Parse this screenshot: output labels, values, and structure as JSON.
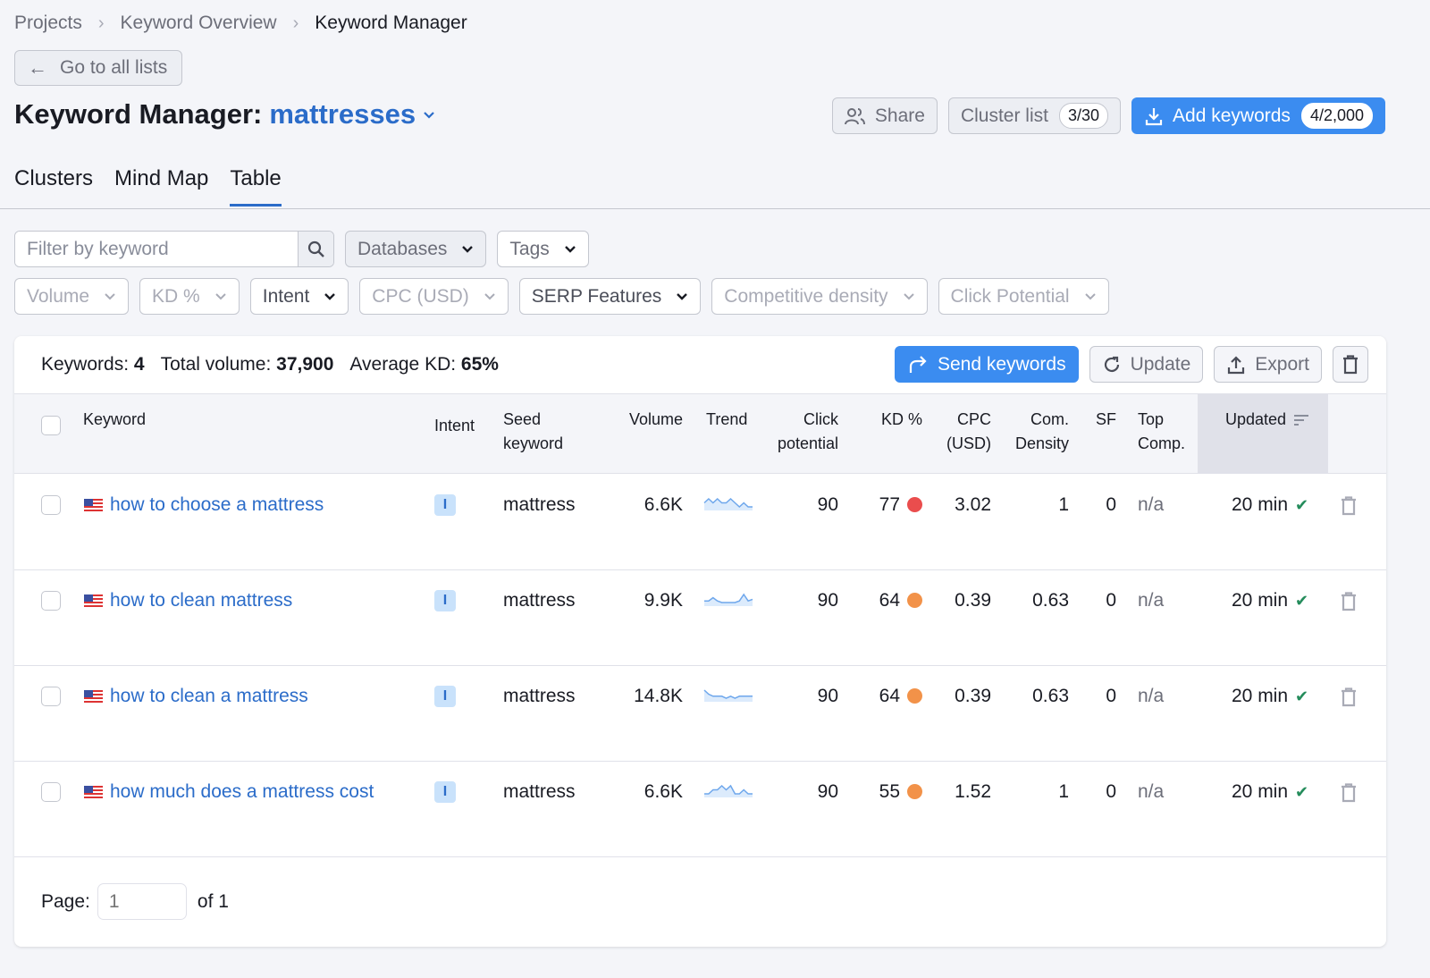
{
  "breadcrumb": [
    "Projects",
    "Keyword Overview",
    "Keyword Manager"
  ],
  "back_button": "Go to all lists",
  "title": {
    "prefix": "Keyword Manager:",
    "list_name": "mattresses"
  },
  "header_actions": {
    "share": "Share",
    "cluster_list": "Cluster list",
    "cluster_count": "3/30",
    "add_keywords": "Add keywords",
    "add_count": "4/2,000"
  },
  "tabs": [
    {
      "label": "Clusters",
      "active": false
    },
    {
      "label": "Mind Map",
      "active": false
    },
    {
      "label": "Table",
      "active": true
    }
  ],
  "filters": {
    "search_placeholder": "Filter by keyword",
    "databases": "Databases",
    "tags": "Tags",
    "volume": "Volume",
    "kd": "KD %",
    "intent": "Intent",
    "cpc": "CPC (USD)",
    "serp": "SERP Features",
    "competitive_density": "Competitive density",
    "click_potential": "Click Potential"
  },
  "summary": {
    "keywords_label": "Keywords:",
    "keywords_value": "4",
    "volume_label": "Total volume:",
    "volume_value": "37,900",
    "kd_label": "Average KD:",
    "kd_value": "65%"
  },
  "table_actions": {
    "send": "Send keywords",
    "update": "Update",
    "export": "Export"
  },
  "columns": {
    "keyword": "Keyword",
    "intent": "Intent",
    "seed_1": "Seed",
    "seed_2": "keyword",
    "volume": "Volume",
    "trend": "Trend",
    "click_1": "Click",
    "click_2": "potential",
    "kd": "KD %",
    "cpc_1": "CPC",
    "cpc_2": "(USD)",
    "com_1": "Com.",
    "com_2": "Density",
    "sf": "SF",
    "top_1": "Top",
    "top_2": "Comp.",
    "updated": "Updated"
  },
  "rows": [
    {
      "keyword": "how to choose a mattress",
      "intent": "I",
      "seed": "mattress",
      "volume": "6.6K",
      "trend": [
        4,
        5,
        4,
        5,
        4,
        4,
        5,
        4,
        3,
        4,
        3,
        3
      ],
      "click": "90",
      "kd": "77",
      "kd_color": "#ea4d4d",
      "cpc": "3.02",
      "com": "1",
      "sf": "0",
      "top": "n/a",
      "updated": "20 min"
    },
    {
      "keyword": "how to clean mattress",
      "intent": "I",
      "seed": "mattress",
      "volume": "9.9K",
      "trend": [
        3,
        3,
        5,
        3,
        2,
        2,
        2,
        2,
        3,
        7,
        3,
        4
      ],
      "click": "90",
      "kd": "64",
      "kd_color": "#f29249",
      "cpc": "0.39",
      "com": "0.63",
      "sf": "0",
      "top": "n/a",
      "updated": "20 min"
    },
    {
      "keyword": "how to clean a mattress",
      "intent": "I",
      "seed": "mattress",
      "volume": "14.8K",
      "trend": [
        7,
        5,
        4,
        4,
        4,
        3,
        4,
        3,
        4,
        4,
        4,
        4
      ],
      "click": "90",
      "kd": "64",
      "kd_color": "#f29249",
      "cpc": "0.39",
      "com": "0.63",
      "sf": "0",
      "top": "n/a",
      "updated": "20 min"
    },
    {
      "keyword": "how much does a mattress cost",
      "intent": "I",
      "seed": "mattress",
      "volume": "6.6K",
      "trend": [
        3,
        3,
        4,
        4,
        5,
        4,
        5,
        3,
        3,
        4,
        3,
        3
      ],
      "click": "90",
      "kd": "55",
      "kd_color": "#f29249",
      "cpc": "1.52",
      "com": "1",
      "sf": "0",
      "top": "n/a",
      "updated": "20 min"
    }
  ],
  "pager": {
    "label": "Page:",
    "value": "1",
    "of": "of 1"
  }
}
